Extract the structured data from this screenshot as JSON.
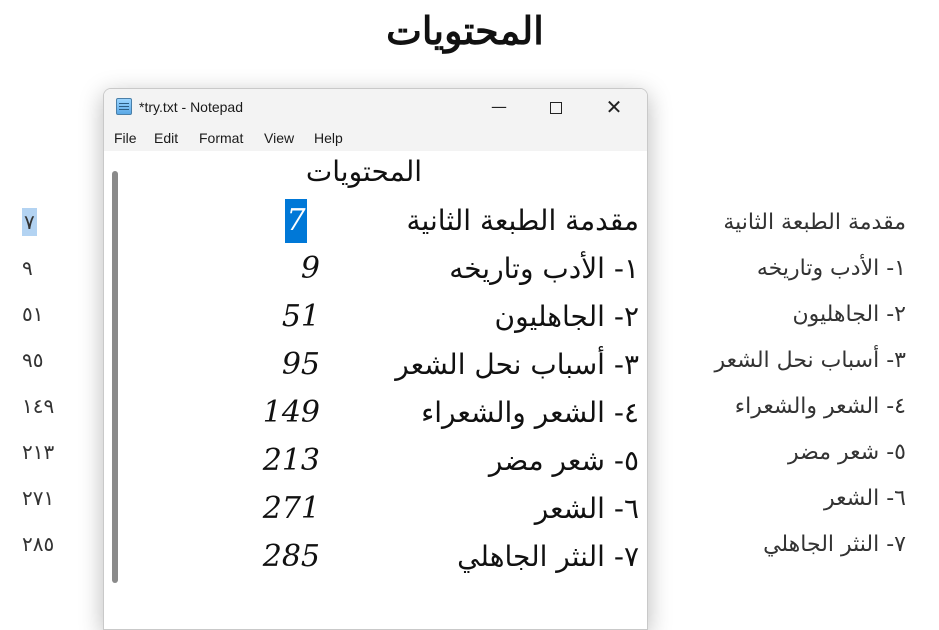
{
  "document": {
    "title": "المحتويات",
    "entries": [
      {
        "label": "مقدمة الطبعة الثانية",
        "page": "٧"
      },
      {
        "label": "١- الأدب وتاريخه",
        "page": "٩"
      },
      {
        "label": "٢- الجاهليون",
        "page": "٥١"
      },
      {
        "label": "٣- أسباب نحل الشعر",
        "page": "٩٥"
      },
      {
        "label": "٤- الشعر والشعراء",
        "page": "١٤٩"
      },
      {
        "label": "٥- شعر مضر",
        "page": "٢١٣"
      },
      {
        "label": "٦- الشعر",
        "page": "٢٧١"
      },
      {
        "label": "٧- النثر الجاهلي",
        "page": "٢٨٥"
      }
    ]
  },
  "notepad": {
    "window_title": "*try.txt - Notepad",
    "controls": {
      "minimize": "—",
      "close": "✕"
    },
    "menu": [
      "File",
      "Edit",
      "Format",
      "View",
      "Help"
    ],
    "editor": {
      "title": "المحتويات",
      "entries": [
        {
          "label": "مقدمة الطبعة الثانية",
          "page": "7"
        },
        {
          "label": "١- الأدب وتاريخه",
          "page": "9"
        },
        {
          "label": "٢- الجاهليون",
          "page": "51"
        },
        {
          "label": "٣- أسباب نحل الشعر",
          "page": "95"
        },
        {
          "label": "٤- الشعر والشعراء",
          "page": "149"
        },
        {
          "label": "٥- شعر مضر",
          "page": "213"
        },
        {
          "label": "٦- الشعر",
          "page": "271"
        },
        {
          "label": "٧- النثر الجاهلي",
          "page": "285"
        }
      ]
    }
  },
  "colors": {
    "selection": "#0078d7",
    "background_selection": "#b3d3f2"
  }
}
